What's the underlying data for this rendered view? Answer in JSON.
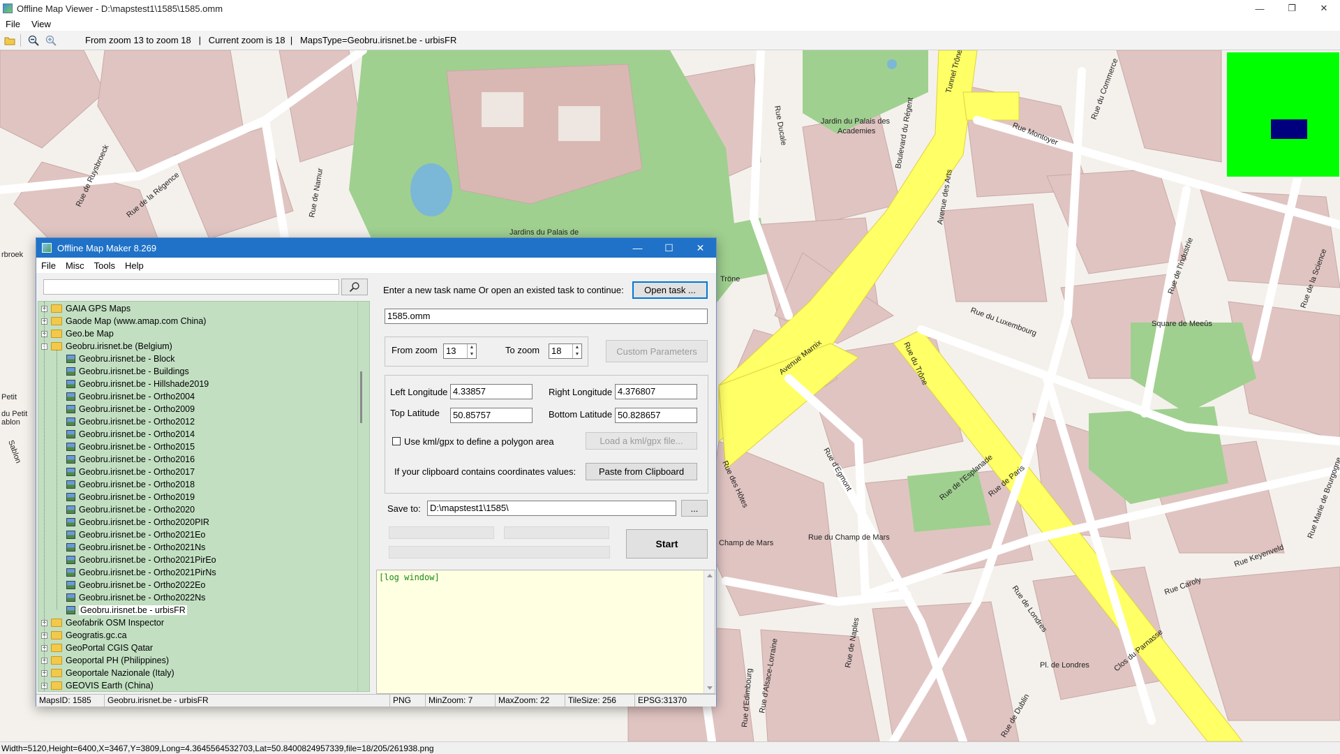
{
  "viewer": {
    "title": "Offline Map Viewer - D:\\mapstest1\\1585\\1585.omm",
    "menu": [
      "File",
      "View"
    ],
    "toolbar_info": "From zoom 13 to zoom 18   |   Current zoom is 18  |   MapsType=Geobru.irisnet.be - urbisFR",
    "status": "Width=5120,Height=6400,X=3467,Y=3809,Long=4.3645564532703,Lat=50.8400824957339,file=18/205/261938.png"
  },
  "map_labels": [
    "Jardin du Palais des",
    "Academies",
    "Jardins du Palais de",
    "Rue Ducale",
    "Rue Montoyer",
    "Rue du Commerce",
    "Boulevard du Régent",
    "Tunnel Trône",
    "Avenue des Arts",
    "Rue de la Régence",
    "Rue de Ruysbroeck",
    "Rue de Namur",
    "Avenue Marnix",
    "Rue du Trône",
    "Rue du Luxembourg",
    "Square de Meeûs",
    "Rue de l'Industrie",
    "Rue de la Science",
    "Rue d'Egmont",
    "Rue de l'Esplanade",
    "Rue de Paris",
    "Rue du Champ de Mars",
    "Champ de Mars",
    "Rue des Hôtes",
    "Rue de Londres",
    "Rue de Naples",
    "Rue d'Alsace-Lorraine",
    "Pl. de Londres",
    "Clos du Parnasse",
    "Rue Caroly",
    "Rue Keyenveld",
    "Rue d'Edimbourg",
    "Rue Marie de Bourgogne",
    "Rue de Dublin",
    "Tröne",
    "Petit",
    "du Petit",
    "ablon",
    "Sablon",
    "rbroek"
  ],
  "dialog": {
    "title": "Offline Map Maker 8.269",
    "menu": [
      "File",
      "Misc",
      "Tools",
      "Help"
    ],
    "search_placeholder": "",
    "tree": [
      {
        "label": "GAIA GPS Maps",
        "type": "folder",
        "exp": "+"
      },
      {
        "label": "Gaode Map (www.amap.com China)",
        "type": "folder",
        "exp": "+"
      },
      {
        "label": "Geo.be Map",
        "type": "folder",
        "exp": "+"
      },
      {
        "label": "Geobru.irisnet.be (Belgium)",
        "type": "folder",
        "exp": "-"
      },
      {
        "label": "Geobru.irisnet.be - Block",
        "type": "map"
      },
      {
        "label": "Geobru.irisnet.be - Buildings",
        "type": "map"
      },
      {
        "label": "Geobru.irisnet.be - Hillshade2019",
        "type": "map"
      },
      {
        "label": "Geobru.irisnet.be - Ortho2004",
        "type": "map"
      },
      {
        "label": "Geobru.irisnet.be - Ortho2009",
        "type": "map"
      },
      {
        "label": "Geobru.irisnet.be - Ortho2012",
        "type": "map"
      },
      {
        "label": "Geobru.irisnet.be - Ortho2014",
        "type": "map"
      },
      {
        "label": "Geobru.irisnet.be - Ortho2015",
        "type": "map"
      },
      {
        "label": "Geobru.irisnet.be - Ortho2016",
        "type": "map"
      },
      {
        "label": "Geobru.irisnet.be - Ortho2017",
        "type": "map"
      },
      {
        "label": "Geobru.irisnet.be - Ortho2018",
        "type": "map"
      },
      {
        "label": "Geobru.irisnet.be - Ortho2019",
        "type": "map"
      },
      {
        "label": "Geobru.irisnet.be - Ortho2020",
        "type": "map"
      },
      {
        "label": "Geobru.irisnet.be - Ortho2020PIR",
        "type": "map"
      },
      {
        "label": "Geobru.irisnet.be - Ortho2021Eo",
        "type": "map"
      },
      {
        "label": "Geobru.irisnet.be - Ortho2021Ns",
        "type": "map"
      },
      {
        "label": "Geobru.irisnet.be - Ortho2021PirEo",
        "type": "map"
      },
      {
        "label": "Geobru.irisnet.be - Ortho2021PirNs",
        "type": "map"
      },
      {
        "label": "Geobru.irisnet.be - Ortho2022Eo",
        "type": "map"
      },
      {
        "label": "Geobru.irisnet.be - Ortho2022Ns",
        "type": "map"
      },
      {
        "label": "Geobru.irisnet.be - urbisFR",
        "type": "map",
        "selected": true
      },
      {
        "label": "Geofabrik OSM Inspector",
        "type": "folder",
        "exp": "+"
      },
      {
        "label": "Geogratis.gc.ca",
        "type": "folder",
        "exp": "+"
      },
      {
        "label": "GeoPortal CGIS Qatar",
        "type": "folder",
        "exp": "+"
      },
      {
        "label": "Geoportal PH (Philippines)",
        "type": "folder",
        "exp": "+"
      },
      {
        "label": "Geoportale Nazionale (Italy)",
        "type": "folder",
        "exp": "+"
      },
      {
        "label": "GEOVIS Earth (China)",
        "type": "folder",
        "exp": "+"
      }
    ],
    "task_prompt": "Enter a new task name Or open an existed task to continue:",
    "open_task_label": "Open task ...",
    "task_name": "1585.omm",
    "from_zoom_label": "From zoom",
    "from_zoom": "13",
    "to_zoom_label": "To zoom",
    "to_zoom": "18",
    "custom_params_label": "Custom Parameters",
    "left_lon_label": "Left Longitude",
    "left_lon": "4.33857",
    "right_lon_label": "Right Longitude",
    "right_lon": "4.376807",
    "top_lat_label": "Top Latitude",
    "top_lat": "50.85757",
    "bottom_lat_label": "Bottom Latitude",
    "bottom_lat": "50.828657",
    "kml_label": "Use kml/gpx to define a polygon area",
    "load_kml_label": "Load a kml/gpx file...",
    "clipboard_prompt": "If your clipboard contains coordinates values:",
    "paste_label": "Paste from Clipboard",
    "save_to_label": "Save to:",
    "save_to": "D:\\mapstest1\\1585\\",
    "browse_label": "...",
    "start_label": "Start",
    "log_text": "[log window]",
    "status": [
      "MapsID: 1585",
      "Geobru.irisnet.be - urbisFR",
      "PNG",
      "MinZoom: 7",
      "MaxZoom: 22",
      "TileSize: 256",
      "EPSG:31370"
    ]
  },
  "colors": {
    "map_building": "#e0c4c2",
    "map_green": "#9fd08f",
    "map_road_yellow": "#ffff66",
    "tree_bg": "#c2dfc2",
    "dialog_title": "#1f72c7",
    "overview_green": "#00ff00",
    "overview_rect": "#00007f"
  }
}
